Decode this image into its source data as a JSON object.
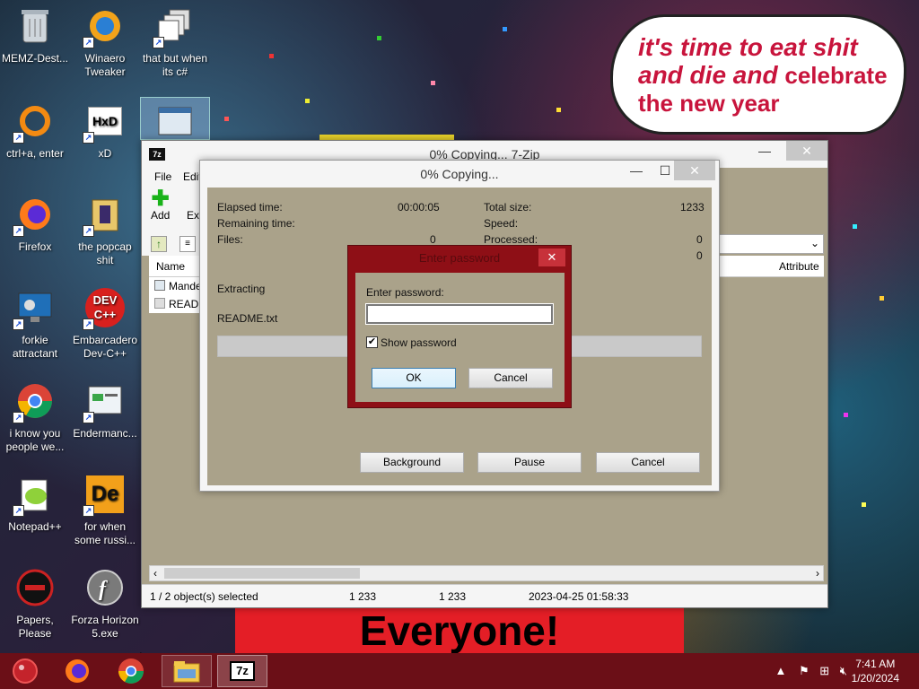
{
  "desktop_icons": [
    {
      "label": "MEMZ-Dest...",
      "icon": "recycle-bin-icon"
    },
    {
      "label": "Winaero Tweaker",
      "icon": "winaero-icon"
    },
    {
      "label": "that but when its c#",
      "icon": "stacked-windows-icon"
    },
    {
      "label": "ctrl+a, enter",
      "icon": "orange-ring-icon"
    },
    {
      "label": "xD",
      "icon": "hxd-icon"
    },
    {
      "label": "Firefox",
      "icon": "firefox-icon"
    },
    {
      "label": "the popcap shit",
      "icon": "popcap-icon"
    },
    {
      "label": "forkie attractant",
      "icon": "monitor-gear-icon"
    },
    {
      "label": "Embarcadero Dev-C++",
      "icon": "devcpp-icon"
    },
    {
      "label": "i know you people we...",
      "icon": "chrome-icon"
    },
    {
      "label": "Endermanc...",
      "icon": "window-app-icon"
    },
    {
      "label": "Notepad++",
      "icon": "notepadpp-icon"
    },
    {
      "label": "for when some russi...",
      "icon": "de-icon"
    },
    {
      "label": "Papers, Please",
      "icon": "papers-please-icon"
    },
    {
      "label": "Forza Horizon 5.exe",
      "icon": "flash-icon"
    }
  ],
  "wallpaper": {
    "bubble_line1": "it's time to eat shit",
    "bubble_line2": "and die and",
    "bubble_line2b": "celebrate",
    "bubble_line3": "the new year",
    "banner": "Everyone!"
  },
  "sevenzip": {
    "title": "0% Copying... 7-Zip",
    "menu": [
      "File",
      "Edit"
    ],
    "toolbar": [
      "Add",
      "Ext"
    ],
    "columns": [
      "Name",
      "Attribute"
    ],
    "files": [
      "Mande",
      "READM"
    ],
    "status": {
      "selected": "1 / 2 object(s) selected",
      "size1": "1 233",
      "size2": "1 233",
      "date": "2023-04-25 01:58:33"
    }
  },
  "progress": {
    "title": "0% Copying...",
    "elapsed_label": "Elapsed time:",
    "elapsed_value": "00:00:05",
    "remaining_label": "Remaining time:",
    "files_label": "Files:",
    "files_value": "0",
    "total_label": "Total size:",
    "total_value": "1233",
    "speed_label": "Speed:",
    "processed_label": "Processed:",
    "processed_value": "0",
    "extra_value": "0",
    "extracting_label": "Extracting",
    "current_file": "README.txt",
    "background_btn": "Background",
    "pause_btn": "Pause",
    "cancel_btn": "Cancel"
  },
  "password_dialog": {
    "title": "Enter password",
    "prompt": "Enter password:",
    "value": "",
    "show_password": "Show password",
    "ok": "OK",
    "cancel": "Cancel"
  },
  "taskbar": {
    "time": "7:41 AM",
    "date": "1/20/2024"
  },
  "colors": {
    "accent": "#8e0f16",
    "taskbar": "#6b0f17",
    "dialog_body": "#aaa28a"
  }
}
